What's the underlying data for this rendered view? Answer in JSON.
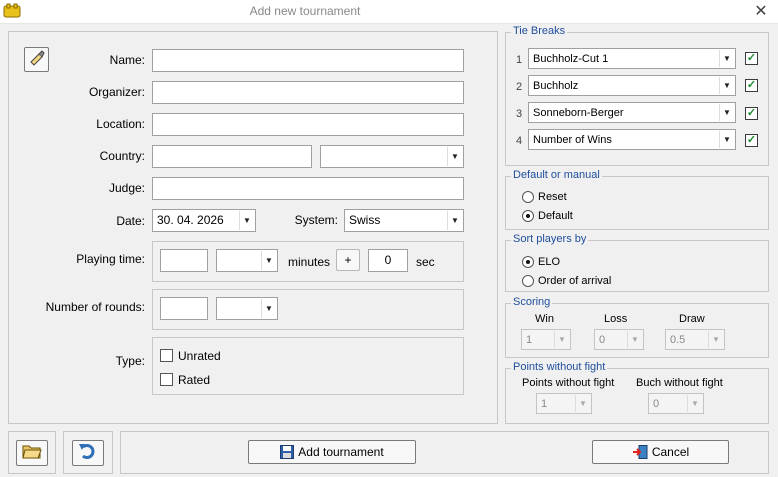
{
  "window": {
    "title": "Add new tournament",
    "close_glyph": "✕"
  },
  "form": {
    "name_label": "Name:",
    "organizer_label": "Organizer:",
    "location_label": "Location:",
    "country_label": "Country:",
    "judge_label": "Judge:",
    "date_label": "Date:",
    "date_value": "30. 04. 2026",
    "system_label": "System:",
    "system_value": "Swiss",
    "playing_time_label": "Playing time:",
    "minutes_label": "minutes",
    "plus_label": "+",
    "seconds_value": "0",
    "sec_label": "sec",
    "rounds_label": "Number of rounds:",
    "type_label": "Type:",
    "unrated_label": "Unrated",
    "rated_label": "Rated"
  },
  "tie_breaks": {
    "title": "Tie Breaks",
    "items": [
      {
        "num": "1",
        "value": "Buchholz-Cut 1",
        "checked": true
      },
      {
        "num": "2",
        "value": "Buchholz",
        "checked": true
      },
      {
        "num": "3",
        "value": "Sonneborn-Berger",
        "checked": true
      },
      {
        "num": "4",
        "value": "Number of Wins",
        "checked": true
      }
    ]
  },
  "default_manual": {
    "title": "Default or manual",
    "reset_label": "Reset",
    "default_label": "Default",
    "selected": "Default"
  },
  "sort_players": {
    "title": "Sort players by",
    "elo_label": "ELO",
    "arrival_label": "Order of arrival",
    "selected": "ELO"
  },
  "scoring": {
    "title": "Scoring",
    "win_label": "Win",
    "loss_label": "Loss",
    "draw_label": "Draw",
    "win_value": "1",
    "loss_value": "0",
    "draw_value": "0.5"
  },
  "points_without_fight": {
    "title": "Points without fight",
    "points_label": "Points without fight",
    "buch_label": "Buch without fight",
    "points_value": "1",
    "buch_value": "0"
  },
  "footer": {
    "add_label": "Add tournament",
    "cancel_label": "Cancel"
  },
  "colors": {
    "group_title": "#1f4e9c",
    "check": "#1c8b2c"
  }
}
